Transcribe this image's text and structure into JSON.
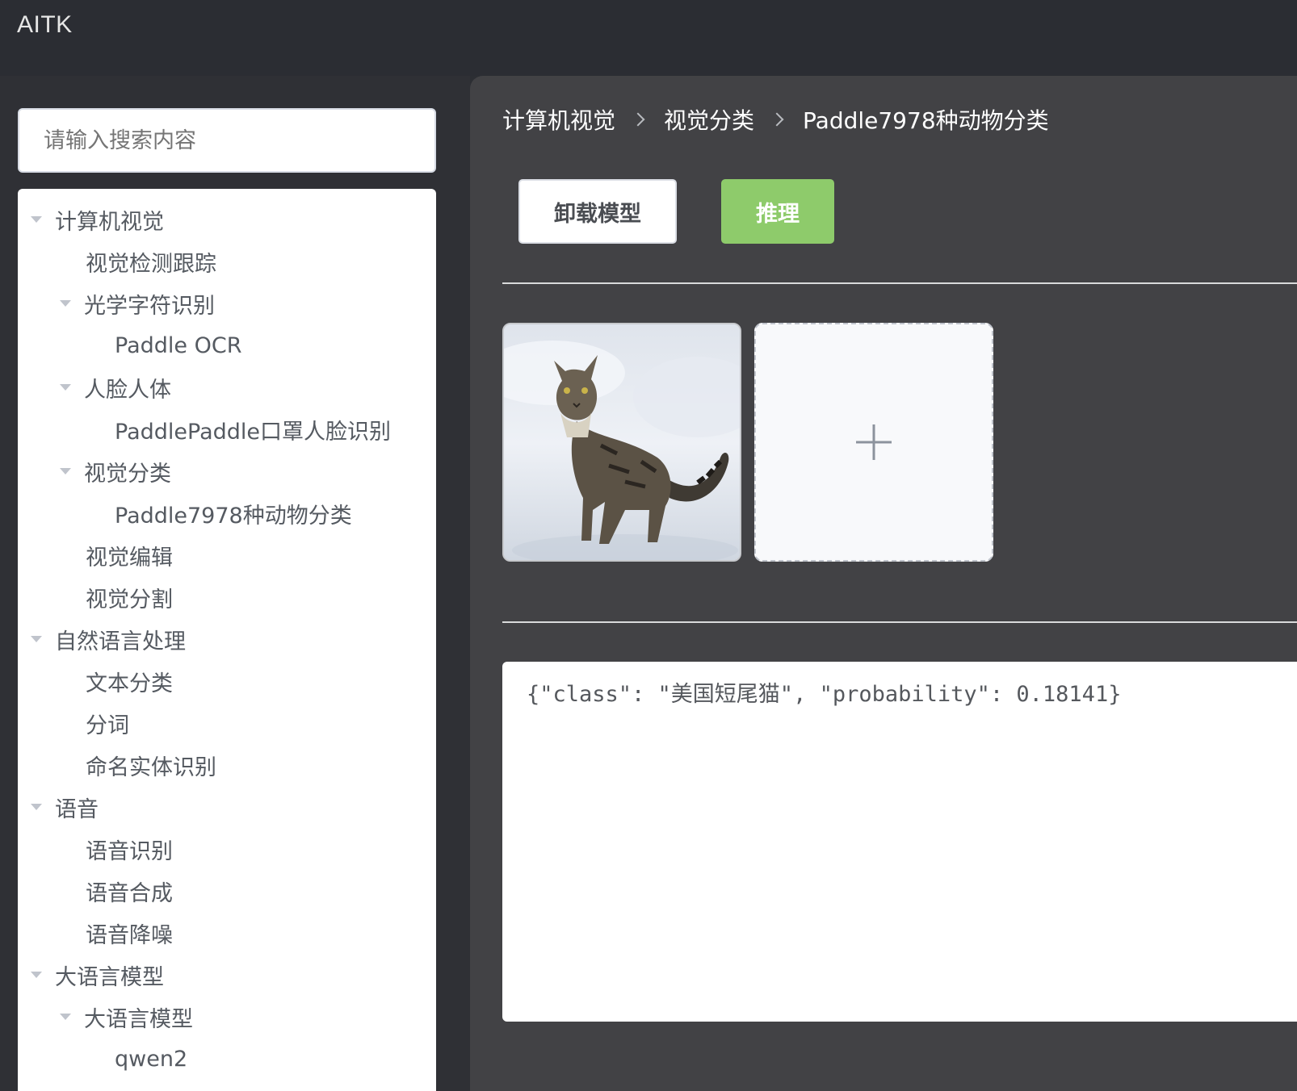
{
  "app": {
    "title": "AITK"
  },
  "search": {
    "placeholder": "请输入搜索内容"
  },
  "tree": {
    "items": [
      {
        "label": "计算机视觉",
        "level": 0,
        "expanded": true
      },
      {
        "label": "视觉检测跟踪",
        "level": 1,
        "expanded": false
      },
      {
        "label": "光学字符识别",
        "level": 1,
        "expanded": true
      },
      {
        "label": "Paddle OCR",
        "level": 2,
        "expanded": false
      },
      {
        "label": "人脸人体",
        "level": 1,
        "expanded": true
      },
      {
        "label": "PaddlePaddle口罩人脸识别",
        "level": 2,
        "expanded": false
      },
      {
        "label": "视觉分类",
        "level": 1,
        "expanded": true
      },
      {
        "label": "Paddle7978种动物分类",
        "level": 2,
        "expanded": false
      },
      {
        "label": "视觉编辑",
        "level": 1,
        "expanded": false
      },
      {
        "label": "视觉分割",
        "level": 1,
        "expanded": false
      },
      {
        "label": "自然语言处理",
        "level": 0,
        "expanded": true
      },
      {
        "label": "文本分类",
        "level": 1,
        "expanded": false
      },
      {
        "label": "分词",
        "level": 1,
        "expanded": false
      },
      {
        "label": "命名实体识别",
        "level": 1,
        "expanded": false
      },
      {
        "label": "语音",
        "level": 0,
        "expanded": true
      },
      {
        "label": "语音识别",
        "level": 1,
        "expanded": false
      },
      {
        "label": "语音合成",
        "level": 1,
        "expanded": false
      },
      {
        "label": "语音降噪",
        "level": 1,
        "expanded": false
      },
      {
        "label": "大语言模型",
        "level": 0,
        "expanded": true
      },
      {
        "label": "大语言模型",
        "level": 1,
        "expanded": true
      },
      {
        "label": "qwen2",
        "level": 2,
        "expanded": false
      }
    ]
  },
  "breadcrumb": [
    "计算机视觉",
    "视觉分类",
    "Paddle7978种动物分类"
  ],
  "toolbar": {
    "unload_label": "卸载模型",
    "infer_label": "推理"
  },
  "result": {
    "text": "{\"class\": \"美国短尾猫\", \"probability\": 0.18141}"
  },
  "colors": {
    "accent_green": "#8ecb6b",
    "topbar": "#2b2d33",
    "main_bg": "#424245"
  }
}
